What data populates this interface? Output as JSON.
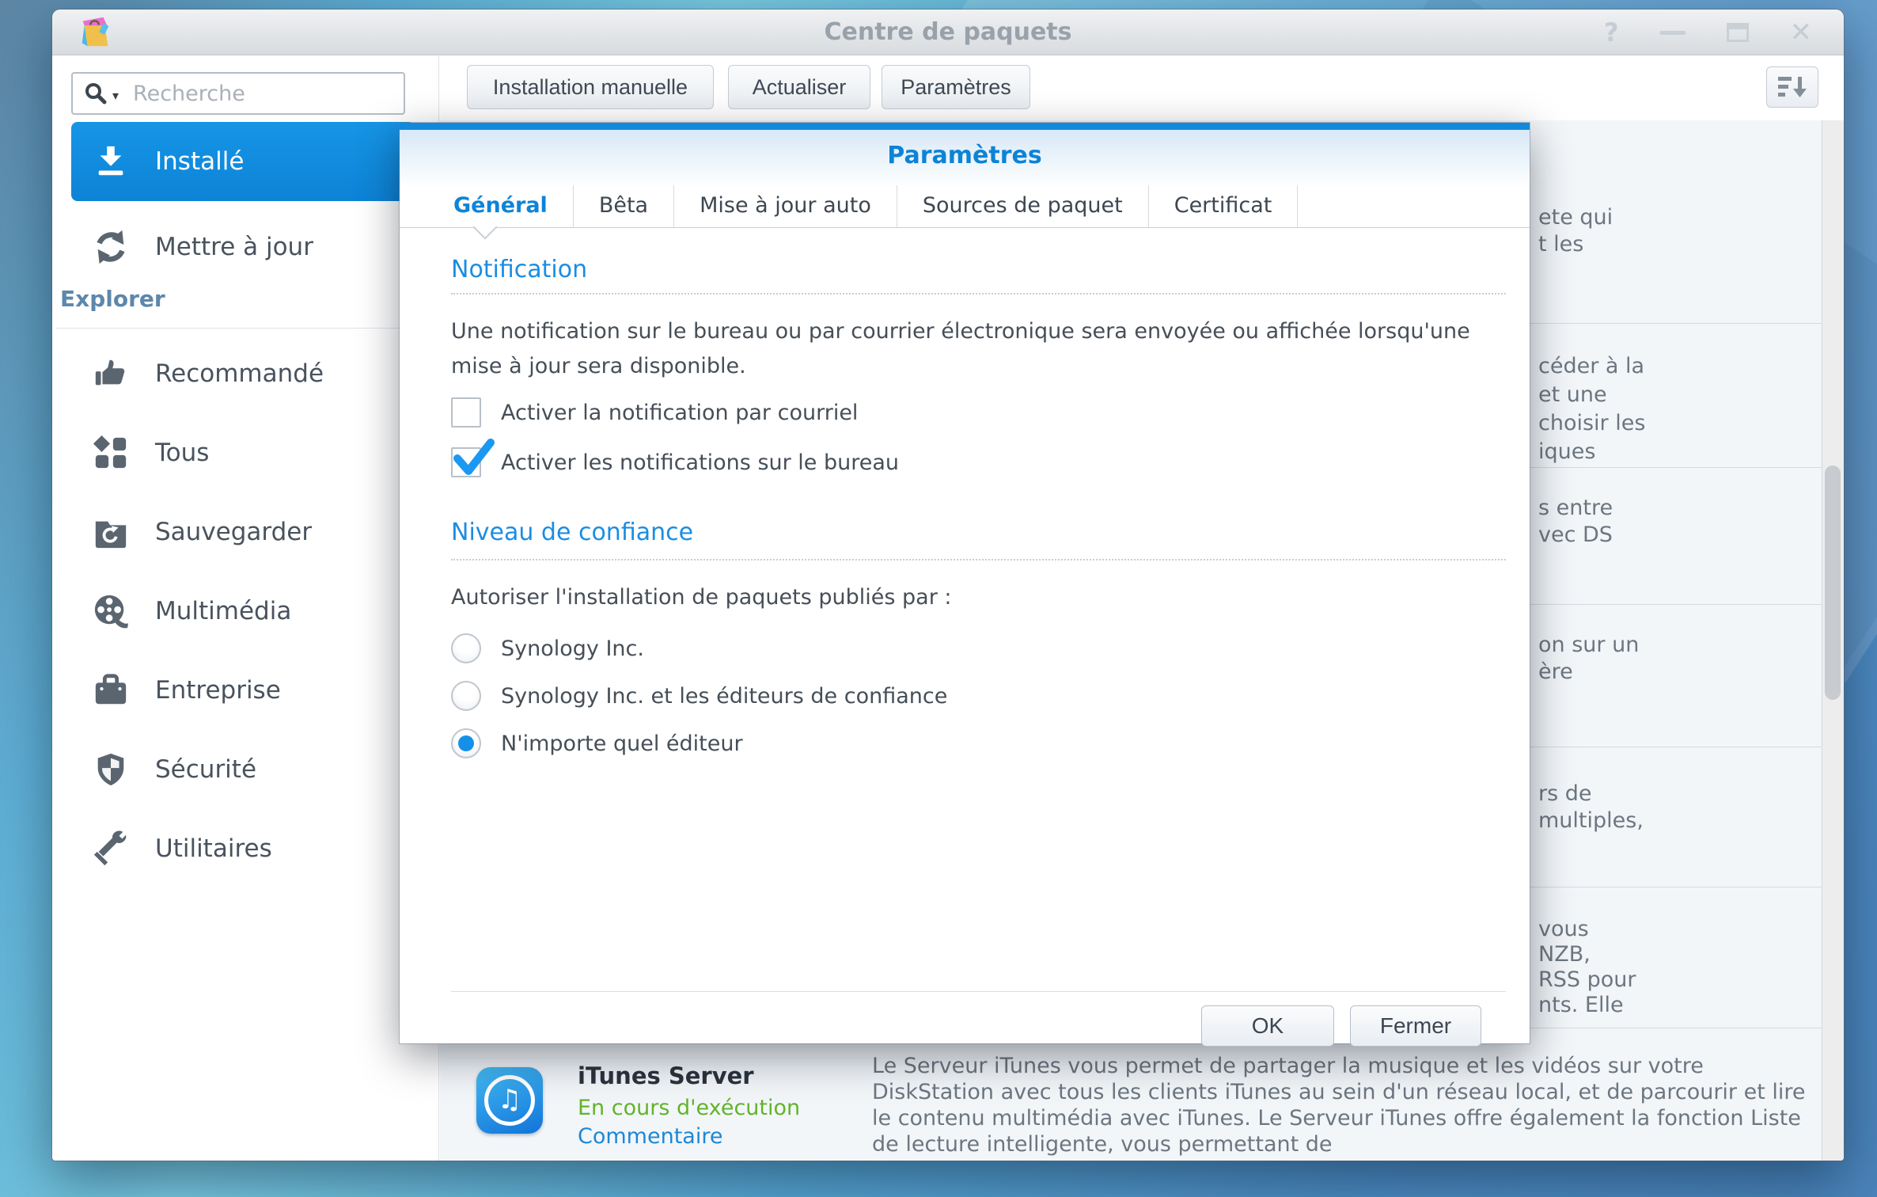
{
  "window": {
    "title": "Centre de paquets"
  },
  "titlebar": {
    "help_glyph": "?",
    "close_glyph": "✕"
  },
  "sidebar": {
    "search": {
      "placeholder": "Recherche"
    },
    "items": [
      {
        "label": "Installé",
        "icon": "download-icon",
        "selected": true
      },
      {
        "label": "Mettre à jour",
        "icon": "refresh-icon",
        "selected": false
      }
    ],
    "explore_heading": "Explorer",
    "explore_items": [
      {
        "label": "Recommandé",
        "icon": "thumbs-up-icon"
      },
      {
        "label": "Tous",
        "icon": "grid-icon"
      },
      {
        "label": "Sauvegarder",
        "icon": "backup-icon"
      },
      {
        "label": "Multimédia",
        "icon": "film-reel-icon"
      },
      {
        "label": "Entreprise",
        "icon": "briefcase-icon"
      },
      {
        "label": "Sécurité",
        "icon": "shield-icon"
      },
      {
        "label": "Utilitaires",
        "icon": "tools-icon"
      }
    ]
  },
  "toolbar": {
    "manual_install": "Installation manuelle",
    "refresh": "Actualiser",
    "settings": "Paramètres",
    "sort_icon": "sort-order-icon"
  },
  "dialog": {
    "title": "Paramètres",
    "tabs": [
      {
        "label": "Général",
        "active": true
      },
      {
        "label": "Bêta",
        "active": false
      },
      {
        "label": "Mise à jour auto",
        "active": false
      },
      {
        "label": "Sources de paquet",
        "active": false
      },
      {
        "label": "Certificat",
        "active": false
      }
    ],
    "notification": {
      "heading": "Notification",
      "description": "Une notification sur le bureau ou par courrier électronique sera envoyée ou affichée lorsqu'une mise à jour sera disponible.",
      "options": [
        {
          "label": "Activer la notification par courriel",
          "checked": false
        },
        {
          "label": "Activer les notifications sur le bureau",
          "checked": true
        }
      ]
    },
    "trust": {
      "heading": "Niveau de confiance",
      "description": "Autoriser l'installation de paquets publiés par :",
      "options": [
        {
          "label": "Synology Inc.",
          "selected": false
        },
        {
          "label": "Synology Inc. et les éditeurs de confiance",
          "selected": false
        },
        {
          "label": "N'importe quel éditeur",
          "selected": true
        }
      ]
    },
    "buttons": {
      "ok": "OK",
      "close": "Fermer"
    }
  },
  "background_rows": [
    {
      "lines": [
        "ete qui",
        "t les"
      ]
    },
    {
      "lines": [
        "céder à la",
        "et une",
        "choisir les",
        "iques"
      ]
    },
    {
      "lines": [
        "s entre",
        "vec DS"
      ]
    },
    {
      "lines": [
        "on sur un",
        "ère"
      ]
    },
    {
      "lines": [
        "rs de",
        "multiples,"
      ]
    },
    {
      "lines": [
        "vous",
        "NZB,",
        "RSS pour",
        "nts. Elle"
      ]
    }
  ],
  "itunes": {
    "name": "iTunes Server",
    "status": "En cours d'exécution",
    "link": "Commentaire",
    "note_glyph": "♫",
    "description": "Le Serveur iTunes vous permet de partager la musique et les vidéos sur votre DiskStation avec tous les clients iTunes au sein d'un réseau local, et de parcourir et lire le contenu multimédia avec iTunes. Le Serveur iTunes offre également la fonction Liste de lecture intelligente, vous permettant de"
  },
  "colors": {
    "accent_blue": "#1089dc",
    "heading_blue": "#1b8de2",
    "dialog_title_blue": "#0d83d6",
    "check_blue": "#1b98f2",
    "status_green": "#63b32a",
    "link_blue": "#1d87d6"
  }
}
